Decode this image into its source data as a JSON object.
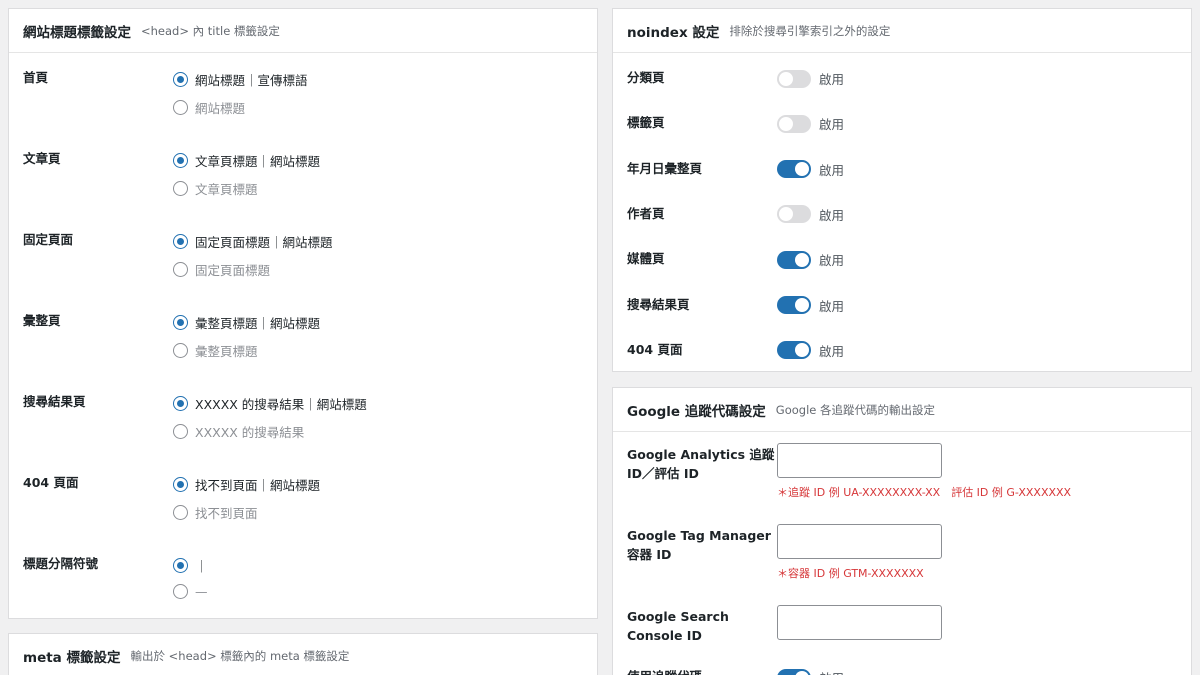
{
  "title_settings": {
    "title": "網站標題標籤設定",
    "subtitle": "<head> 內 title 標籤設定",
    "rows": [
      {
        "label": "首頁",
        "options": [
          "網站標題｜宣傳標語",
          "網站標題"
        ],
        "selected": 0
      },
      {
        "label": "文章頁",
        "options": [
          "文章頁標題｜網站標題",
          "文章頁標題"
        ],
        "selected": 0
      },
      {
        "label": "固定頁面",
        "options": [
          "固定頁面標題｜網站標題",
          "固定頁面標題"
        ],
        "selected": 0
      },
      {
        "label": "彙整頁",
        "options": [
          "彙整頁標題｜網站標題",
          "彙整頁標題"
        ],
        "selected": 0
      },
      {
        "label": "搜尋結果頁",
        "options": [
          "XXXXX 的搜尋結果｜網站標題",
          "XXXXX 的搜尋結果"
        ],
        "selected": 0
      },
      {
        "label": "404 頁面",
        "options": [
          "找不到頁面｜網站標題",
          "找不到頁面"
        ],
        "selected": 0
      },
      {
        "label": "標題分隔符號",
        "options": [
          "｜",
          "—"
        ],
        "selected": 0
      }
    ]
  },
  "meta_settings": {
    "title": "meta 標籤設定",
    "subtitle": "輸出於 <head> 標籤內的 meta 標籤設定"
  },
  "noindex": {
    "title": "noindex 設定",
    "subtitle": "排除於搜尋引擎索引之外的設定",
    "toggle_label": "啟用",
    "rows": [
      {
        "label": "分類頁",
        "on": false
      },
      {
        "label": "標籤頁",
        "on": false
      },
      {
        "label": "年月日彙整頁",
        "on": true
      },
      {
        "label": "作者頁",
        "on": false
      },
      {
        "label": "媒體頁",
        "on": true
      },
      {
        "label": "搜尋結果頁",
        "on": true
      },
      {
        "label": "404 頁面",
        "on": true
      }
    ]
  },
  "google": {
    "title": "Google 追蹤代碼設定",
    "subtitle": "Google 各追蹤代碼的輸出設定",
    "fields": [
      {
        "label": "Google Analytics 追蹤 ID／評估 ID",
        "value": "",
        "hint": "＊追蹤 ID 例 UA-XXXXXXXX-XX　評估 ID 例 G-XXXXXXX"
      },
      {
        "label": "Google Tag Manager 容器 ID",
        "value": "",
        "hint": "＊容器 ID 例 GTM-XXXXXXX"
      },
      {
        "label": "Google Search Console ID",
        "value": "",
        "hint": ""
      }
    ],
    "partial_label": "使用追蹤代碼",
    "partial_toggle_label": "啟用",
    "partial_on": true
  },
  "colors": {
    "accent": "#2271b1",
    "hint": "#d63638",
    "toggle_off": "#dcdcde"
  }
}
